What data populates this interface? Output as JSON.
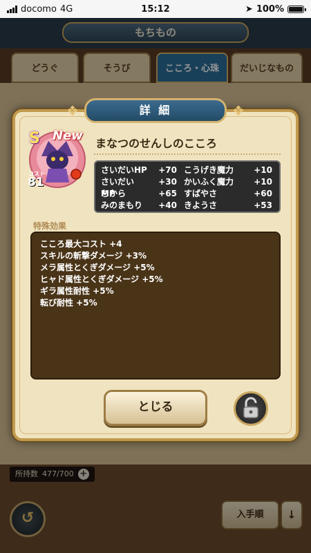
{
  "status_bar": {
    "carrier": "docomo",
    "network": "4G",
    "time": "15:12",
    "battery": "100%"
  },
  "screen": {
    "title": "もちもの"
  },
  "tabs": [
    {
      "label": "どうぐ"
    },
    {
      "label": "そうび"
    },
    {
      "label": "こころ・心珠",
      "active": true
    },
    {
      "label": "だいじなもの"
    }
  ],
  "footer": {
    "owned_label": "所持数",
    "owned_value": "477/700",
    "plus": "+",
    "back": "↺",
    "sort_label": "入手順",
    "sort_arrow": "↓"
  },
  "modal": {
    "title": "詳 細",
    "item": {
      "rank": "S",
      "new_tag": "New",
      "cost_label": "コスト",
      "cost": "81",
      "name": "まなつのせんしのこころ"
    },
    "stats": [
      {
        "name1": "さいだいHP",
        "val1": "+70",
        "name2": "こうげき魔力",
        "val2": "+10"
      },
      {
        "name1": "さいだいMP",
        "val1": "+30",
        "name2": "かいふく魔力",
        "val2": "+10"
      },
      {
        "name1": "ちから",
        "val1": "+65",
        "name2": "すばやさ",
        "val2": "+60"
      },
      {
        "name1": "みのまもり",
        "val1": "+40",
        "name2": "きようさ",
        "val2": "+53"
      }
    ],
    "special_heading": "特殊効果",
    "special_effects": [
      "こころ最大コスト +4",
      "スキルの斬撃ダメージ +3%",
      "メラ属性とくぎダメージ +5%",
      "ヒャド属性とくぎダメージ +5%",
      "ギラ属性耐性 +5%",
      "転び耐性 +5%"
    ],
    "close_label": "とじる"
  },
  "colors": {
    "accent": "#2c6f99",
    "gold": "#c19a4e",
    "panel": "#f0e3bf"
  }
}
